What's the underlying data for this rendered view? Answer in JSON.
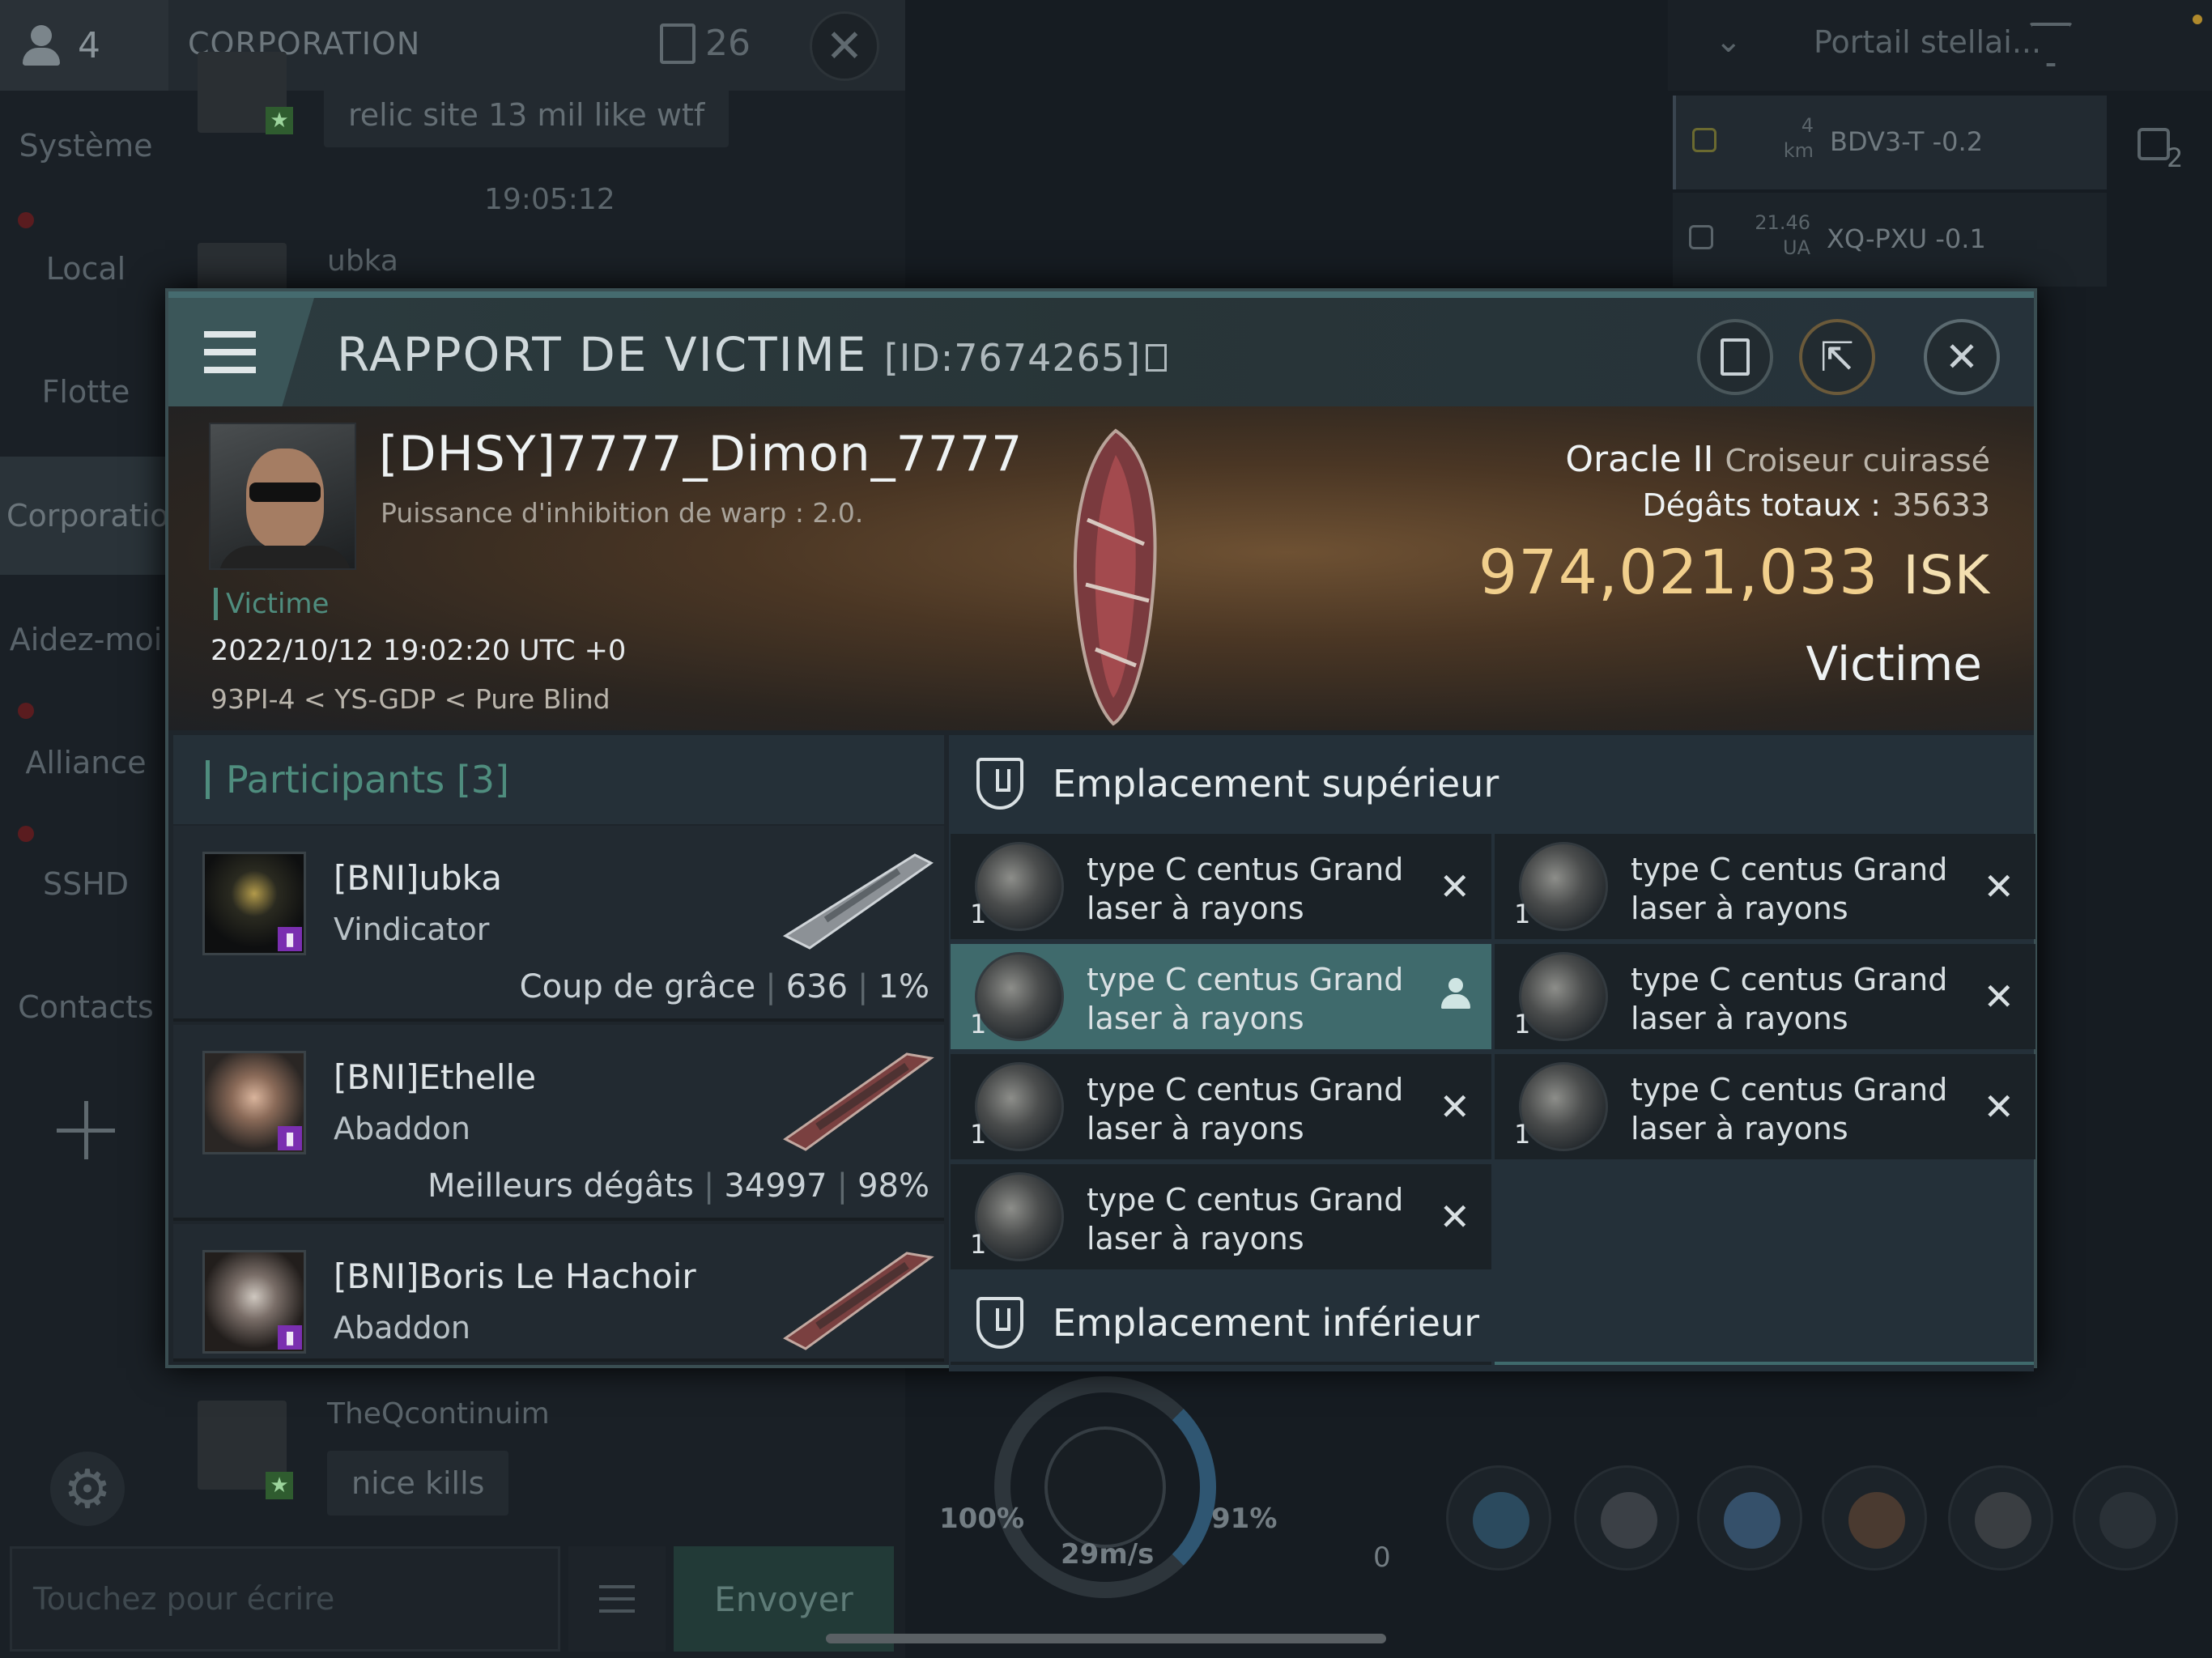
{
  "chat": {
    "user_count": "4",
    "title": "CORPORATION",
    "message_count": "26",
    "tabs": [
      {
        "label": "Système"
      },
      {
        "label": "Local"
      },
      {
        "label": "Flotte"
      },
      {
        "label": "Corporation"
      },
      {
        "label": "Aidez-moi"
      },
      {
        "label": "Alliance"
      },
      {
        "label": "SSHD"
      },
      {
        "label": "Contacts"
      }
    ],
    "messages": [
      {
        "text": "relic site 13 mil like wtf"
      },
      {
        "time": "19:05:12"
      },
      {
        "author": "ubka"
      },
      {
        "author": "TheQcontinuim",
        "text": "nice kills"
      }
    ],
    "input_placeholder": "Touchez pour écrire",
    "send_label": "Envoyer"
  },
  "overview": {
    "filter_label": "Portail stellai...",
    "rows": [
      {
        "distance_value": "4",
        "distance_unit": "km",
        "name": "BDV3-T -0.2"
      },
      {
        "distance_value": "21.46",
        "distance_unit": "UA",
        "name": "XQ-PXU -0.1"
      }
    ],
    "side_count": "2"
  },
  "hud": {
    "shield_percent": "100%",
    "cap_percent": "91%",
    "speed": "29m/s",
    "zero": "0"
  },
  "report": {
    "title": "RAPPORT DE VICTIME",
    "report_id": "[ID:7674265]",
    "victim": {
      "name": "[DHSY]7777_Dimon_7777",
      "warp_strength": "Puissance d'inhibition de warp : 2.0.",
      "tag": "Victime",
      "datetime": "2022/10/12 19:02:20 UTC +0",
      "location": "93PI-4 < YS-GDP < Pure Blind",
      "ship_name": "Oracle II",
      "ship_class": "Croiseur cuirassé",
      "damage_label": "Dégâts totaux :",
      "damage_value": "35633",
      "isk_value": "974,021,033",
      "isk_unit": "ISK",
      "role": "Victime"
    },
    "participants_header": "Participants [3]",
    "participants": [
      {
        "name": "[BNI]ubka",
        "ship": "Vindicator",
        "stat_label": "Coup de grâce",
        "damage": "636",
        "percent": "1%"
      },
      {
        "name": "[BNI]Ethelle",
        "ship": "Abaddon",
        "stat_label": "Meilleurs dégâts",
        "damage": "34997",
        "percent": "98%"
      },
      {
        "name": "[BNI]Boris Le Hachoir",
        "ship": "Abaddon",
        "stat_label": "",
        "damage": "",
        "percent": ""
      }
    ],
    "high_slots_header": "Emplacement supérieur",
    "low_slots_header": "Emplacement inférieur",
    "high_slots": [
      {
        "qty": "1",
        "line1": "type C centus Grand",
        "line2": "laser à rayons",
        "status": "destroyed"
      },
      {
        "qty": "1",
        "line1": "type C centus Grand",
        "line2": "laser à rayons",
        "status": "destroyed"
      },
      {
        "qty": "1",
        "line1": "type C centus Grand",
        "line2": "laser à rayons",
        "status": "dropped"
      },
      {
        "qty": "1",
        "line1": "type C centus Grand",
        "line2": "laser à rayons",
        "status": "destroyed"
      },
      {
        "qty": "1",
        "line1": "type C centus Grand",
        "line2": "laser à rayons",
        "status": "destroyed"
      },
      {
        "qty": "1",
        "line1": "type C centus Grand",
        "line2": "laser à rayons",
        "status": "destroyed"
      },
      {
        "qty": "1",
        "line1": "type C centus Grand",
        "line2": "laser à rayons",
        "status": "destroyed"
      }
    ],
    "colors": {
      "accent": "#4f8d7e",
      "isk": "#f1cf8c",
      "selected_slot": "#3f6a6c",
      "corp_badge": "#7a2fb0"
    }
  }
}
